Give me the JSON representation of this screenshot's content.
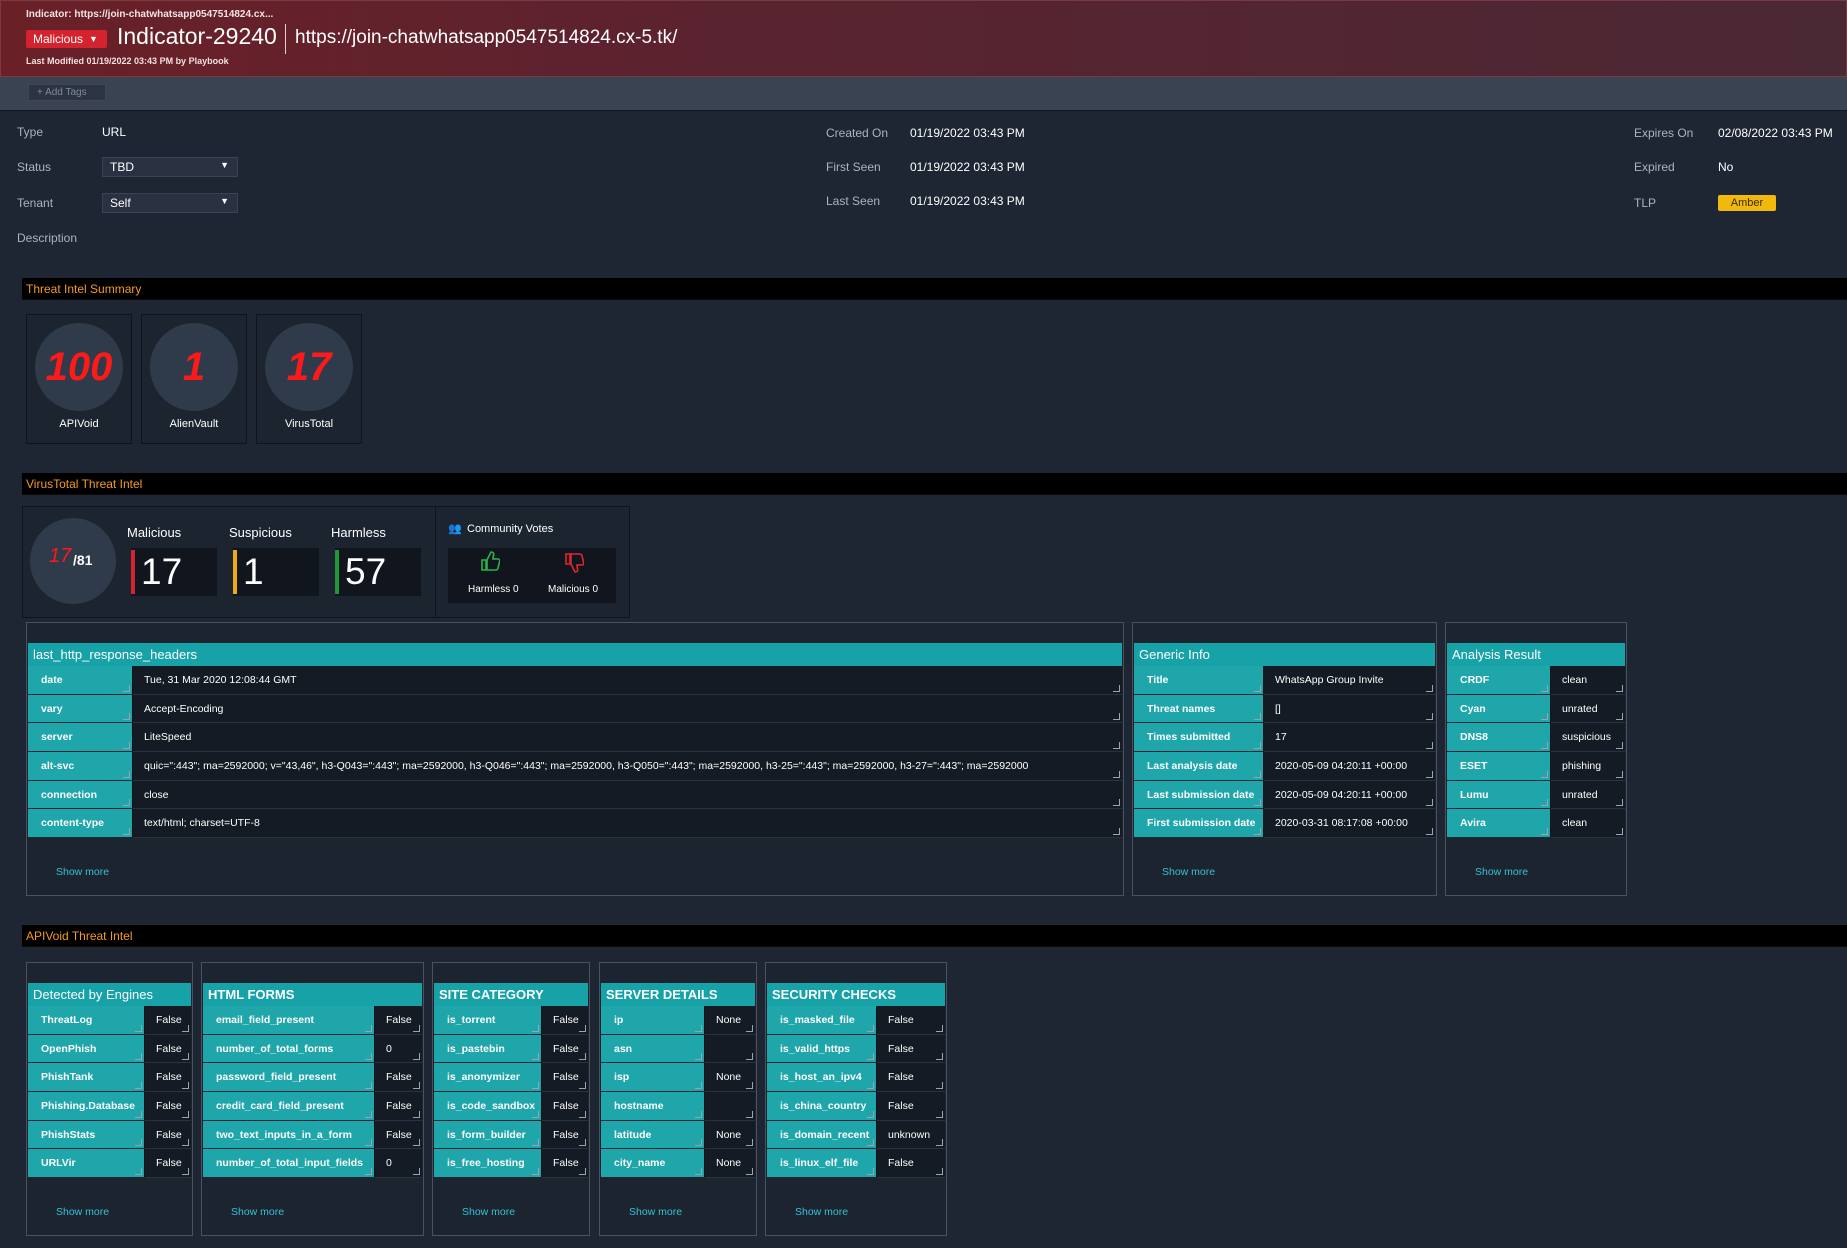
{
  "header": {
    "breadcrumb": "Indicator: https://join-chatwhatsapp0547514824.cx...",
    "verdict": "Malicious",
    "indicator_id": "Indicator-29240",
    "indicator_value": "https://join-chatwhatsapp0547514824.cx-5.tk/",
    "last_modified": "Last Modified 01/19/2022 03:43 PM by Playbook"
  },
  "tags": {
    "add_label": "+ Add Tags"
  },
  "fields": {
    "type_label": "Type",
    "type_value": "URL",
    "status_label": "Status",
    "status_value": "TBD",
    "tenant_label": "Tenant",
    "tenant_value": "Self",
    "description_label": "Description",
    "created_label": "Created On",
    "created_value": "01/19/2022 03:43 PM",
    "first_seen_label": "First Seen",
    "first_seen_value": "01/19/2022 03:43 PM",
    "last_seen_label": "Last Seen",
    "last_seen_value": "01/19/2022 03:43 PM",
    "expires_label": "Expires On",
    "expires_value": "02/08/2022 03:43 PM",
    "expired_label": "Expired",
    "expired_value": "No",
    "tlp_label": "TLP",
    "tlp_value": "Amber"
  },
  "colors": {
    "malicious": "#d3232e",
    "accent": "#f59a1f",
    "teal": "#1fa6ab",
    "tlp_amber": "#f1b80d",
    "suspicious": "#f0a81a",
    "harmless": "#1f9a38"
  },
  "threat_summary": {
    "title": "Threat Intel Summary",
    "scores": [
      {
        "value": "100",
        "source": "APIVoid"
      },
      {
        "value": "1",
        "source": "AlienVault"
      },
      {
        "value": "17",
        "source": "VirusTotal"
      }
    ]
  },
  "virustotal": {
    "title": "VirusTotal Threat Intel",
    "detected": "17",
    "total": "/81",
    "malicious_label": "Malicious",
    "malicious_value": "17",
    "suspicious_label": "Suspicious",
    "suspicious_value": "1",
    "harmless_label": "Harmless",
    "harmless_value": "57",
    "community_title": "Community Votes",
    "votes_harmless": "Harmless 0",
    "votes_malicious": "Malicious 0",
    "http_headers": {
      "title": "last_http_response_headers",
      "rows": [
        {
          "k": "date",
          "v": "Tue, 31 Mar 2020 12:08:44 GMT"
        },
        {
          "k": "vary",
          "v": "Accept-Encoding"
        },
        {
          "k": "server",
          "v": "LiteSpeed"
        },
        {
          "k": "alt-svc",
          "v": "quic=\":443\"; ma=2592000; v=\"43,46\", h3-Q043=\":443\"; ma=2592000, h3-Q046=\":443\"; ma=2592000, h3-Q050=\":443\"; ma=2592000, h3-25=\":443\"; ma=2592000, h3-27=\":443\"; ma=2592000"
        },
        {
          "k": "connection",
          "v": "close"
        },
        {
          "k": "content-type",
          "v": "text/html; charset=UTF-8"
        }
      ],
      "show_more": "Show more"
    },
    "generic_info": {
      "title": "Generic Info",
      "rows": [
        {
          "k": "Title",
          "v": "WhatsApp Group Invite"
        },
        {
          "k": "Threat names",
          "v": "[]"
        },
        {
          "k": "Times submitted",
          "v": "17"
        },
        {
          "k": "Last analysis date",
          "v": "2020-05-09 04:20:11 +00:00"
        },
        {
          "k": "Last submission date",
          "v": "2020-05-09 04:20:11 +00:00"
        },
        {
          "k": "First submission date",
          "v": "2020-03-31 08:17:08 +00:00"
        }
      ],
      "show_more": "Show more"
    },
    "analysis_result": {
      "title": "Analysis Result",
      "rows": [
        {
          "k": "CRDF",
          "v": "clean"
        },
        {
          "k": "Cyan",
          "v": "unrated"
        },
        {
          "k": "DNS8",
          "v": "suspicious"
        },
        {
          "k": "ESET",
          "v": "phishing"
        },
        {
          "k": "Lumu",
          "v": "unrated"
        },
        {
          "k": "Avira",
          "v": "clean"
        }
      ],
      "show_more": "Show more"
    }
  },
  "apivoid": {
    "title": "APIVoid Threat Intel",
    "engines": {
      "title": "Detected by Engines",
      "rows": [
        {
          "k": "ThreatLog",
          "v": "False"
        },
        {
          "k": "OpenPhish",
          "v": "False"
        },
        {
          "k": "PhishTank",
          "v": "False"
        },
        {
          "k": "Phishing.Database",
          "v": "False"
        },
        {
          "k": "PhishStats",
          "v": "False"
        },
        {
          "k": "URLVir",
          "v": "False"
        }
      ],
      "show_more": "Show more"
    },
    "html_forms": {
      "title": "HTML FORMS",
      "rows": [
        {
          "k": "email_field_present",
          "v": "False"
        },
        {
          "k": "number_of_total_forms",
          "v": "0"
        },
        {
          "k": "password_field_present",
          "v": "False"
        },
        {
          "k": "credit_card_field_present",
          "v": "False"
        },
        {
          "k": "two_text_inputs_in_a_form",
          "v": "False"
        },
        {
          "k": "number_of_total_input_fields",
          "v": "0"
        }
      ],
      "show_more": "Show more"
    },
    "site_category": {
      "title": "SITE CATEGORY",
      "rows": [
        {
          "k": "is_torrent",
          "v": "False"
        },
        {
          "k": "is_pastebin",
          "v": "False"
        },
        {
          "k": "is_anonymizer",
          "v": "False"
        },
        {
          "k": "is_code_sandbox",
          "v": "False"
        },
        {
          "k": "is_form_builder",
          "v": "False"
        },
        {
          "k": "is_free_hosting",
          "v": "False"
        }
      ],
      "show_more": "Show more"
    },
    "server_details": {
      "title": "SERVER DETAILS",
      "rows": [
        {
          "k": "ip",
          "v": "None"
        },
        {
          "k": "asn",
          "v": ""
        },
        {
          "k": "isp",
          "v": "None"
        },
        {
          "k": "hostname",
          "v": ""
        },
        {
          "k": "latitude",
          "v": "None"
        },
        {
          "k": "city_name",
          "v": "None"
        }
      ],
      "show_more": "Show more"
    },
    "security_checks": {
      "title": "SECURITY CHECKS",
      "rows": [
        {
          "k": "is_masked_file",
          "v": "False"
        },
        {
          "k": "is_valid_https",
          "v": "False"
        },
        {
          "k": "is_host_an_ipv4",
          "v": "False"
        },
        {
          "k": "is_china_country",
          "v": "False"
        },
        {
          "k": "is_domain_recent",
          "v": "unknown"
        },
        {
          "k": "is_linux_elf_file",
          "v": "False"
        }
      ],
      "show_more": "Show more"
    }
  }
}
